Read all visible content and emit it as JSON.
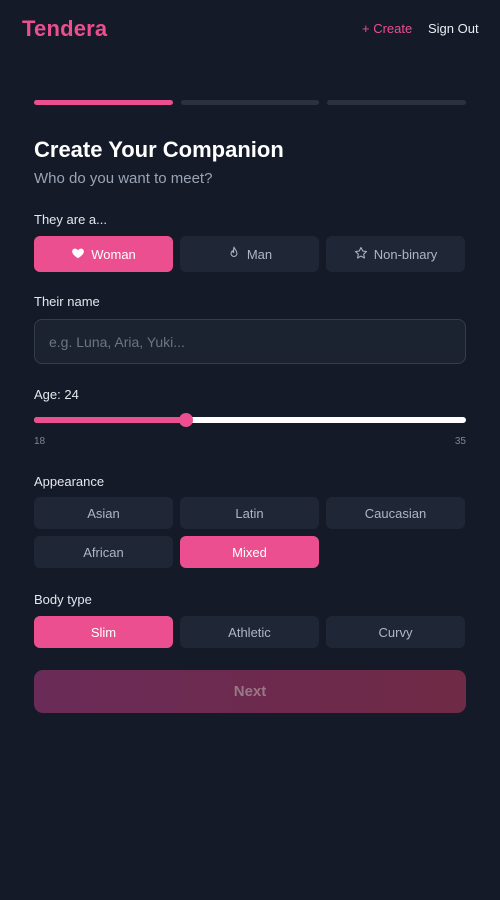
{
  "header": {
    "logo": "Tendera",
    "create_label": "+ Create",
    "signout_label": "Sign Out"
  },
  "progress": {
    "steps": 3,
    "current": 1
  },
  "form": {
    "title": "Create Your Companion",
    "subtitle": "Who do you want to meet?",
    "gender": {
      "label": "They are a...",
      "options": [
        {
          "label": "Woman",
          "icon": "heart-icon",
          "selected": true
        },
        {
          "label": "Man",
          "icon": "flame-icon",
          "selected": false
        },
        {
          "label": "Non-binary",
          "icon": "star-icon",
          "selected": false
        }
      ]
    },
    "name": {
      "label": "Their name",
      "placeholder": "e.g. Luna, Aria, Yuki...",
      "value": ""
    },
    "age": {
      "label": "Age: 24",
      "value": 24,
      "min": 18,
      "max": 35,
      "min_label": "18",
      "max_label": "35"
    },
    "appearance": {
      "label": "Appearance",
      "options": [
        {
          "label": "Asian",
          "selected": false
        },
        {
          "label": "Latin",
          "selected": false
        },
        {
          "label": "Caucasian",
          "selected": false
        },
        {
          "label": "African",
          "selected": false
        },
        {
          "label": "Mixed",
          "selected": true
        }
      ]
    },
    "body_type": {
      "label": "Body type",
      "options": [
        {
          "label": "Slim",
          "selected": true
        },
        {
          "label": "Athletic",
          "selected": false
        },
        {
          "label": "Curvy",
          "selected": false
        }
      ]
    },
    "next_label": "Next"
  },
  "colors": {
    "accent": "#ec4f8f",
    "background": "#141a28",
    "chip": "#1f2635"
  }
}
